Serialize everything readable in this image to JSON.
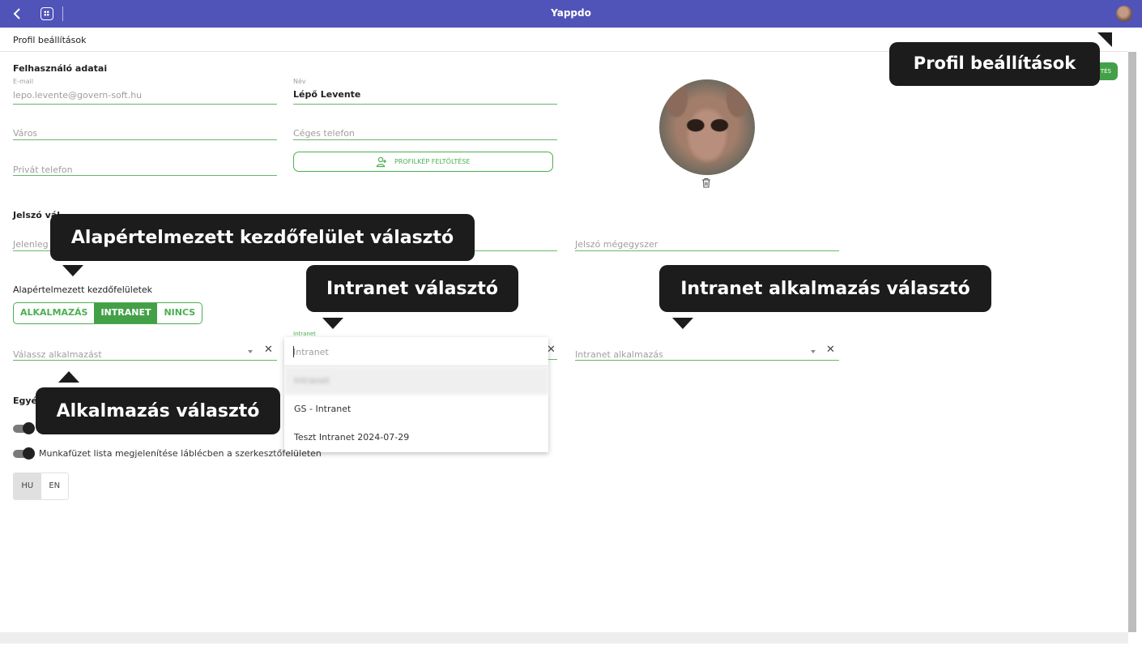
{
  "app": {
    "title": "Yappdo"
  },
  "page": {
    "title": "Profil beállítások"
  },
  "user_section": {
    "title": "Felhasználó adatai",
    "email_label": "E-mail",
    "email_value": "lepo.levente@govern-soft.hu",
    "name_label": "Név",
    "name_value": "Lépő Levente",
    "city_placeholder": "Város",
    "company_phone_placeholder": "Céges telefon",
    "private_phone_placeholder": "Privát telefon",
    "upload_button": "PROFILKÉP FELTÖLTÉSE"
  },
  "save_button": "TÉS",
  "password_section": {
    "title": "Jelszó vál",
    "current_placeholder": "Jelenleg",
    "repeat_placeholder": "Jelszó mégegyszer"
  },
  "default_views": {
    "title": "Alapértelmezett kezdőfelületek",
    "options": [
      "ALKALMAZÁS",
      "INTRANET",
      "NINCS"
    ],
    "selected": "INTRANET"
  },
  "app_select": {
    "placeholder": "Válassz alkalmazást",
    "clear": "✕"
  },
  "intranet_select": {
    "label": "Intranet",
    "search_placeholder": "Intranet",
    "clear": "✕",
    "options": [
      "Intranet",
      "GS - Intranet",
      "Teszt Intranet 2024-07-29"
    ],
    "highlighted_index": 0
  },
  "intranet_app_select": {
    "placeholder": "Intranet alkalmazás",
    "clear": "✕"
  },
  "other_section": {
    "title": "Egyé",
    "switch2_label": "Munkafüzet lista megjelenítése láblécben a szerkesztőfelületen"
  },
  "languages": {
    "options": [
      "HU",
      "EN"
    ],
    "selected": "HU"
  },
  "callouts": {
    "profile": "Profil beállítások",
    "default_view": "Alapértelmezett kezdőfelület választó",
    "intranet": "Intranet választó",
    "intranet_app": "Intranet alkalmazás választó",
    "app": "Alkalmazás választó"
  },
  "colors": {
    "topbar": "#5053b8",
    "accent": "#4caf50",
    "callout_bg": "#1c1c1c"
  },
  "icons": [
    "back-icon",
    "apps-grid-icon",
    "user-avatar-icon",
    "add-person-icon",
    "trash-icon",
    "chevron-down-icon",
    "close-icon"
  ]
}
